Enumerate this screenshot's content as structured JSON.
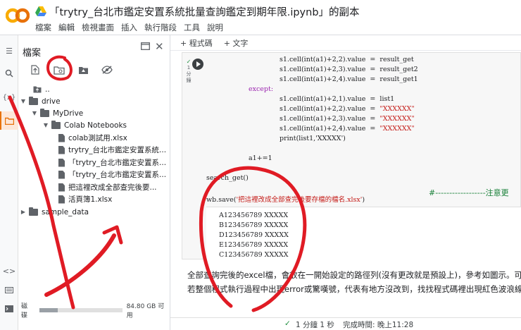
{
  "header": {
    "title": "「trytry_台北市鑑定安置系統批量查詢鑑定到期年限.ipynb」的副本",
    "menu": [
      "檔案",
      "編輯",
      "檢視畫面",
      "插入",
      "執行階段",
      "工具",
      "說明"
    ]
  },
  "files_panel": {
    "title": "檔案",
    "tree": [
      {
        "label": "..",
        "depth": 0,
        "kind": "up"
      },
      {
        "label": "drive",
        "depth": 0,
        "kind": "folder",
        "expanded": true
      },
      {
        "label": "MyDrive",
        "depth": 1,
        "kind": "folder",
        "expanded": true
      },
      {
        "label": "Colab Notebooks",
        "depth": 2,
        "kind": "folder",
        "expanded": true
      },
      {
        "label": "colab測試用.xlsx",
        "depth": 3,
        "kind": "file"
      },
      {
        "label": "trytry_台北市鑑定安置系統...",
        "depth": 3,
        "kind": "file"
      },
      {
        "label": "「trytry_台北市鑑定安置系...",
        "depth": 3,
        "kind": "file"
      },
      {
        "label": "「trytry_台北市鑑定安置系...",
        "depth": 3,
        "kind": "file"
      },
      {
        "label": "把這裡改成全部查完後要...",
        "depth": 3,
        "kind": "file"
      },
      {
        "label": "活頁簿1.xlsx",
        "depth": 3,
        "kind": "file"
      },
      {
        "label": "sample_data",
        "depth": 0,
        "kind": "folder",
        "expanded": false
      }
    ],
    "disk_label": "磁碟",
    "disk_free": "84.80 GB 可用",
    "disk_used_fraction": 0.22
  },
  "notebook": {
    "toolbar": {
      "add_code": "+ 程式碼",
      "add_text": "+ 文字"
    },
    "exec_info": {
      "check": "✓",
      "lines": [
        "1",
        "分",
        "鐘"
      ]
    },
    "code_lines": [
      {
        "indent": 2,
        "text": "s1.cell(int(a1)+2,2).value  =  result_get"
      },
      {
        "indent": 2,
        "text": "s1.cell(int(a1)+2,3).value  =  result_get2"
      },
      {
        "indent": 2,
        "text": "s1.cell(int(a1)+2,4).value  =  result_get1"
      },
      {
        "indent": 1,
        "text": "except:",
        "cls": "kw"
      },
      {
        "indent": 2,
        "text": "s1.cell(int(a1)+2,1).value  =  list1"
      },
      {
        "indent": 2,
        "text": "s1.cell(int(a1)+2,2).value  =  \"XXXXXX\"",
        "str": true
      },
      {
        "indent": 2,
        "text": "s1.cell(int(a1)+2,3).value  =  \"XXXXXX\"",
        "str": true
      },
      {
        "indent": 2,
        "text": "s1.cell(int(a1)+2,4).value  =  \"XXXXXX\"",
        "str": true
      },
      {
        "indent": 2,
        "text": "print(list1,'XXXXX')"
      },
      {
        "indent": 0,
        "text": ""
      },
      {
        "indent": 1,
        "text": "a1+=1"
      },
      {
        "indent": 0,
        "text": ""
      },
      {
        "indent": 0,
        "text": "search_get()"
      },
      {
        "indent": 0,
        "text": ""
      },
      {
        "indent": 0,
        "text": "wb.save('把這裡改成全部查完後要存檔的檔名.xlsx')"
      }
    ],
    "code_comment": "#------------------注意更",
    "output_lines": [
      "A123456789 XXXXX",
      "B123456789 XXXXX",
      "D123456789 XXXXX",
      "E123456789 XXXXX",
      "C123456789 XXXXX"
    ],
    "text_cell": [
      "全部查詢完後的excel檔，會放在一開始設定的路徑列(沒有更改就是預設上)，參考如圖示。可",
      "若整個程式執行過程中出現error或驚嘆號，代表有地方沒改到，找找程式碼裡出現紅色波浪線"
    ]
  },
  "status": {
    "check": "✓",
    "elapsed": "1 分鐘 1 秒",
    "completed": "完成時間: 晚上11:28"
  },
  "colors": {
    "accent_orange": "#e8710a",
    "annotation_red": "#e01b24",
    "ok_green": "#1e8e3e"
  }
}
